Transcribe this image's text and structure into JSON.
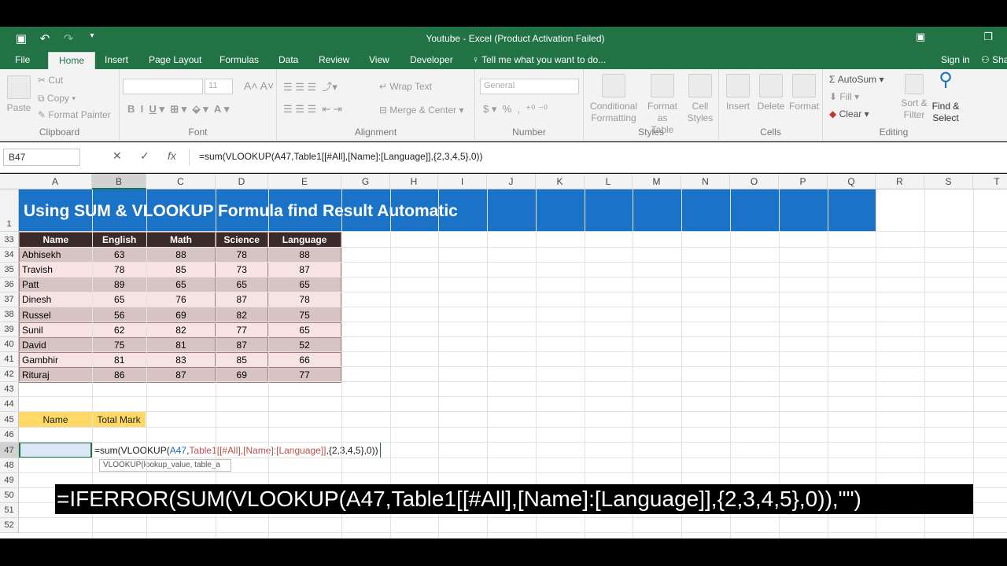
{
  "window": {
    "title": "Youtube - Excel (Product Activation Failed)"
  },
  "tabs": [
    {
      "label": "File"
    },
    {
      "label": "Home"
    },
    {
      "label": "Insert"
    },
    {
      "label": "Page Layout"
    },
    {
      "label": "Formulas"
    },
    {
      "label": "Data"
    },
    {
      "label": "Review"
    },
    {
      "label": "View"
    },
    {
      "label": "Developer"
    }
  ],
  "tell_me": "Tell me what you want to do...",
  "account": {
    "sign_in": "Sign in",
    "share": "Sha"
  },
  "ribbon": {
    "clipboard": {
      "paste": "Paste",
      "cut": "Cut",
      "copy": "Copy",
      "format_painter": "Format Painter",
      "label": "Clipboard"
    },
    "font": {
      "size": "11",
      "label": "Font"
    },
    "alignment": {
      "wrap_text": "Wrap Text",
      "merge_center": "Merge & Center",
      "label": "Alignment"
    },
    "number": {
      "format": "General",
      "label": "Number"
    },
    "styles": {
      "conditional_1": "Conditional",
      "conditional_2": "Formatting",
      "format_as_1": "Format as",
      "format_as_2": "Table",
      "cell_1": "Cell",
      "cell_2": "Styles",
      "label": "Styles"
    },
    "cells": {
      "insert": "Insert",
      "delete": "Delete",
      "format": "Format",
      "label": "Cells"
    },
    "editing": {
      "autosum": "AutoSum",
      "fill": "Fill",
      "clear": "Clear",
      "sort_1": "Sort &",
      "sort_2": "Filter",
      "find_1": "Find &",
      "find_2": "Select",
      "label": "Editing"
    }
  },
  "formula_bar": {
    "name_box": "B47",
    "formula": "=sum(VLOOKUP(A47,Table1[[#All],[Name]:[Language]],{2,3,4,5},0))"
  },
  "columns": [
    "A",
    "B",
    "C",
    "D",
    "E",
    "G",
    "H",
    "I",
    "J",
    "K",
    "L",
    "M",
    "N",
    "O",
    "P",
    "Q",
    "R",
    "S",
    "T"
  ],
  "rows": [
    "1",
    "33",
    "34",
    "35",
    "36",
    "37",
    "38",
    "39",
    "40",
    "41",
    "42",
    "43",
    "44",
    "45",
    "46",
    "47",
    "48",
    "49",
    "50",
    "51",
    "52"
  ],
  "banner": "Using SUM & VLOOKUP Formula find Result Automatic",
  "table": {
    "headers": [
      "Name",
      "English",
      "Math",
      "Science",
      "Language"
    ],
    "rows": [
      [
        "Abhisekh",
        "63",
        "88",
        "78",
        "88"
      ],
      [
        "Travish",
        "78",
        "85",
        "73",
        "87"
      ],
      [
        "Patt",
        "89",
        "65",
        "65",
        "65"
      ],
      [
        "Dinesh",
        "65",
        "76",
        "87",
        "78"
      ],
      [
        "Russel",
        "56",
        "69",
        "82",
        "75"
      ],
      [
        "Sunil",
        "62",
        "82",
        "77",
        "65"
      ],
      [
        "David",
        "75",
        "81",
        "87",
        "52"
      ],
      [
        "Gambhir",
        "81",
        "83",
        "85",
        "66"
      ],
      [
        "Rituraj",
        "86",
        "87",
        "69",
        "77"
      ]
    ]
  },
  "lookup": {
    "name_header": "Name",
    "total_header": "Total Mark"
  },
  "editing_cell": {
    "text": "=sum(VLOOKUP(A47,Table1[[#All],[Name]:[Language]],{2,3,4,5},0))",
    "tooltip": "VLOOKUP(lookup_value, table_a"
  },
  "caption": "=IFERROR(SUM(VLOOKUP(A47,Table1[[#All],[Name]:[Language]],{2,3,4,5},0)),\"\")",
  "colors": {
    "excel_green": "#217346",
    "banner_blue": "#1a73c6",
    "header_yellow": "#ffd966",
    "table_header": "#3a2a2a"
  }
}
